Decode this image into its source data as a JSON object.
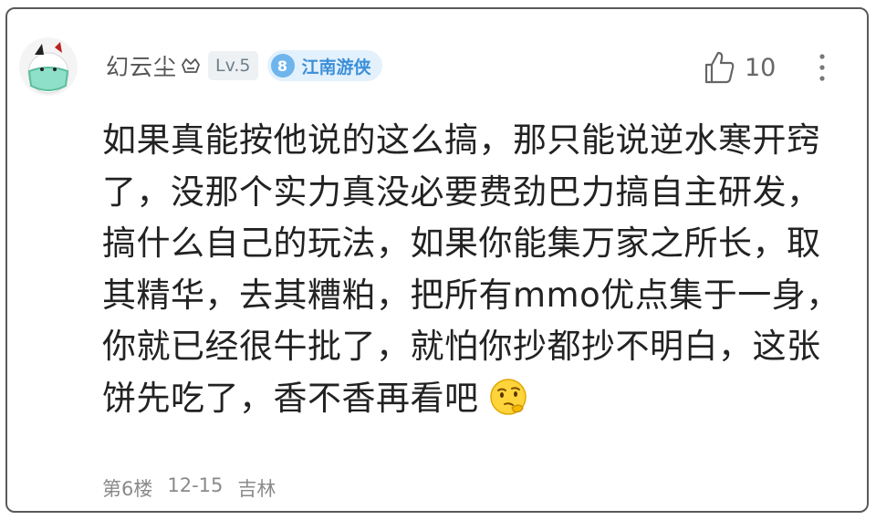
{
  "comment": {
    "username": "幻云尘",
    "level": "Lv.5",
    "honor": {
      "number": "8",
      "title": "江南游侠"
    },
    "likes": "10",
    "text": "如果真能按他说的这么搞，那只能说逆水寒开窍了，没那个实力真没必要费劲巴力搞自主研发，搞什么自己的玩法，如果你能集万家之所长，取其精华，去其糟粕，把所有mmo优点集于一身，你就已经很牛批了，就怕你抄都抄不明白，这张饼先吃了，香不香再看吧",
    "footer": {
      "floor": "第6楼",
      "date": "12-15",
      "location": "吉林"
    }
  },
  "icons": {
    "avatar": "masked-face-avatar",
    "vip": "vip-badge-icon",
    "like": "thumbs-up-icon",
    "more": "more-vertical-icon",
    "emoji": "thinking-face-emoji"
  },
  "colors": {
    "card_border": "#5a5a5a",
    "honor_bg": "#e3f1fc",
    "honor_accent": "#3b8fd9",
    "level_bg": "#eef1f3"
  }
}
